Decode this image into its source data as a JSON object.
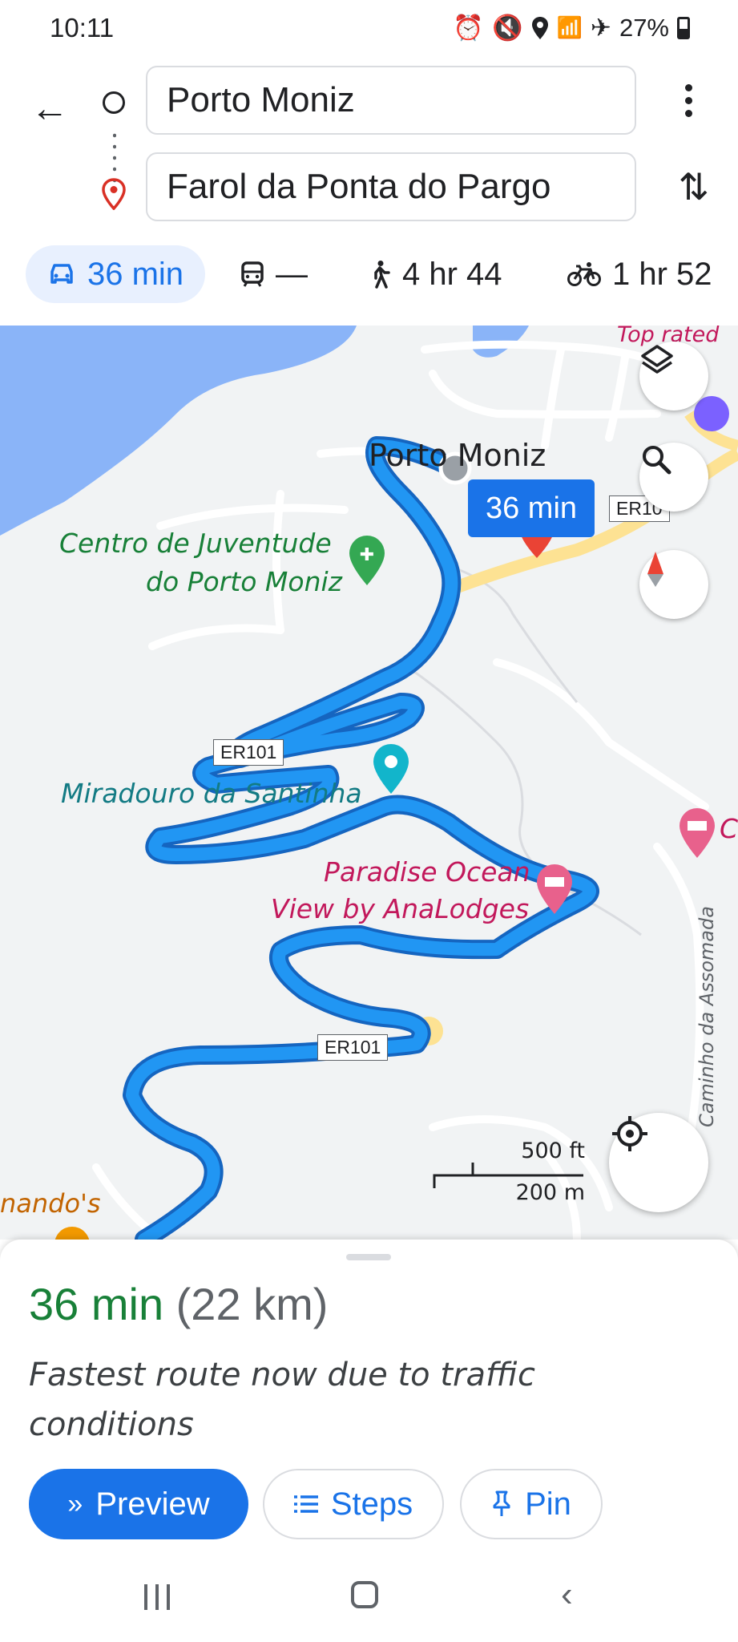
{
  "status_bar": {
    "time": "10:11",
    "battery": "27%",
    "icons": [
      "alarm-icon",
      "mute-icon",
      "location-icon",
      "wifi-calling-icon",
      "airplane-icon",
      "battery-icon"
    ]
  },
  "header": {
    "origin": "Porto Moniz",
    "destination": "Farol da Ponta do Pargo",
    "modes": [
      {
        "icon": "car-icon",
        "label": "36 min",
        "selected": true
      },
      {
        "icon": "transit-icon",
        "label": "—",
        "selected": false
      },
      {
        "icon": "walk-icon",
        "label": "4 hr 44",
        "selected": false
      },
      {
        "icon": "bike-icon",
        "label": "1 hr 52",
        "selected": false
      }
    ]
  },
  "map": {
    "top_rated": "Top rated",
    "place_porto_moniz": "Porto Moniz",
    "route_chip": "36 min",
    "poi_centro": "Centro de Juventude",
    "poi_centro_2": "do Porto Moniz",
    "poi_miradouro": "Miradouro da Santinha",
    "poi_paradise": "Paradise Ocean",
    "poi_paradise_2": "View by AnaLodges",
    "poi_edge_right": "C",
    "poi_edge_left": "nando's",
    "street": "Caminho da Assomada",
    "road_shields": [
      "ER101",
      "ER101",
      "ER10"
    ],
    "scale_ft": "500 ft",
    "scale_m": "200 m",
    "colors": {
      "route": "#2196f3",
      "route_outline": "#1565c0",
      "water": "#8ab4f8",
      "land": "#f1f3f4"
    }
  },
  "sheet": {
    "eta_time": "36 min",
    "eta_distance": "(22 km)",
    "reason": "Fastest route now due to traffic conditions",
    "preview_label": "Preview",
    "steps_label": "Steps",
    "pin_label": "Pin"
  },
  "colors": {
    "accent": "#1a73e8",
    "eta_green": "#188038"
  }
}
